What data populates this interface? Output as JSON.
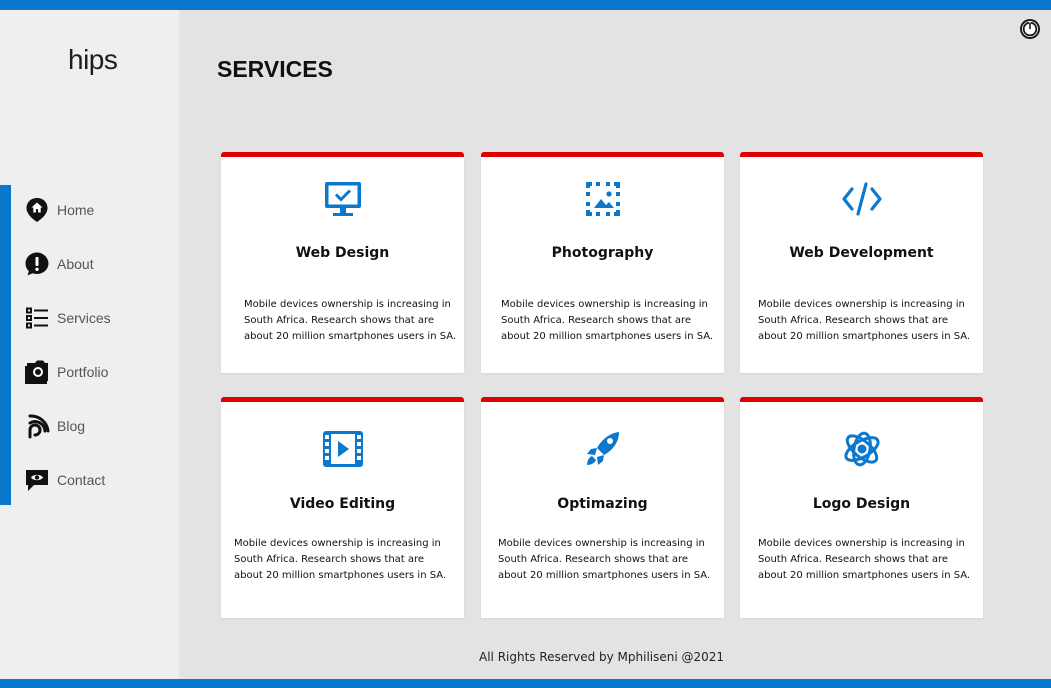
{
  "app": {
    "logo": "hips"
  },
  "nav": {
    "items": [
      {
        "label": "Home",
        "icon": "home-pin-icon"
      },
      {
        "label": "About",
        "icon": "exclamation-icon"
      },
      {
        "label": "Services",
        "icon": "list-icon"
      },
      {
        "label": "Portfolio",
        "icon": "camera-icon"
      },
      {
        "label": "Blog",
        "icon": "rss-icon"
      },
      {
        "label": "Contact",
        "icon": "chat-eye-icon"
      }
    ]
  },
  "header": {
    "title": "SERVICES",
    "power_icon": "power-icon"
  },
  "cards": [
    {
      "title": "Web Design",
      "icon": "monitor-check-icon",
      "desc": [
        "Mobile devices ownership is increasing in",
        "South Africa. Research shows that are",
        "about  20 million smartphones users in SA."
      ]
    },
    {
      "title": "Photography",
      "icon": "image-frame-icon",
      "desc": [
        "Mobile devices ownership is increasing in",
        "South Africa. Research shows that are",
        "about  20 million smartphones users in SA."
      ]
    },
    {
      "title": "Web Development",
      "icon": "code-icon",
      "desc": [
        "Mobile devices ownership is increasing in",
        "South Africa. Research shows that are",
        "about  20 million smartphones users in SA."
      ]
    },
    {
      "title": "Video Editing",
      "icon": "film-play-icon",
      "desc": [
        "Mobile devices ownership is increasing in",
        "South Africa. Research shows that are",
        "about  20 million smartphones users in SA."
      ]
    },
    {
      "title": "Optimazing",
      "icon": "rocket-icon",
      "desc": [
        "Mobile devices ownership is increasing in",
        "South Africa. Research shows that are",
        "about  20 million smartphones users in SA."
      ]
    },
    {
      "title": "Logo Design",
      "icon": "atom-logo-icon",
      "desc": [
        "Mobile devices ownership is increasing in",
        "South Africa. Research shows that are",
        "about  20 million smartphones users in SA."
      ]
    }
  ],
  "footer": {
    "text": "All Rights Reserved by Mphiliseni @2021"
  },
  "colors": {
    "accent": "#0a78cd",
    "card_top": "#e00000",
    "background": "#e3e3e3",
    "sidebar": "#efefef"
  }
}
